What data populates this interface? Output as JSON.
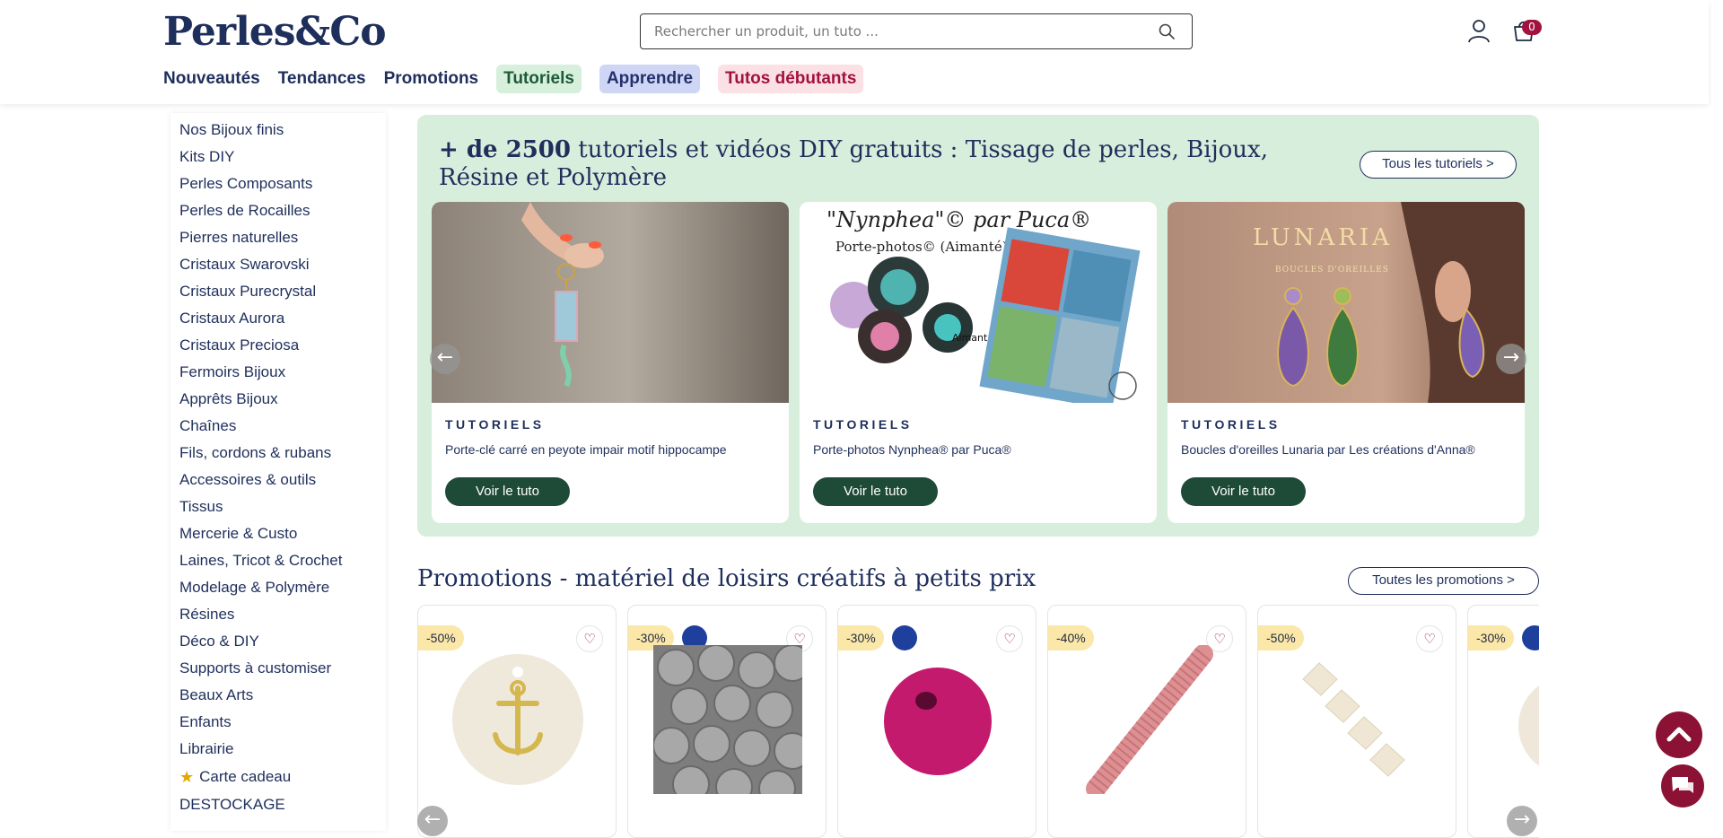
{
  "header": {
    "logo": "Perles&Co",
    "search_placeholder": "Rechercher un produit, un tuto ...",
    "cart_count": "0"
  },
  "nav": [
    {
      "label": "Nouveautés",
      "style": "plain"
    },
    {
      "label": "Tendances",
      "style": "plain"
    },
    {
      "label": "Promotions",
      "style": "plain"
    },
    {
      "label": "Tutoriels",
      "style": "green"
    },
    {
      "label": "Apprendre",
      "style": "blue"
    },
    {
      "label": "Tutos débutants",
      "style": "pink"
    }
  ],
  "sidebar": {
    "items": [
      "Nos Bijoux finis",
      "Kits DIY",
      "Perles Composants",
      "Perles de Rocailles",
      "Pierres naturelles",
      "Cristaux Swarovski",
      "Cristaux Purecrystal",
      "Cristaux Aurora",
      "Cristaux Preciosa",
      "Fermoirs Bijoux",
      "Apprêts Bijoux",
      "Chaînes",
      "Fils, cordons & rubans",
      "Accessoires & outils",
      "Tissus",
      "Mercerie & Custo",
      "Laines, Tricot & Crochet",
      "Modelage & Polymère",
      "Résines",
      "Déco & DIY",
      "Supports à customiser",
      "Beaux Arts",
      "Enfants",
      "Librairie"
    ],
    "gift_card": "Carte cadeau",
    "destockage": "DESTOCKAGE"
  },
  "tutorials": {
    "title_bold": "+ de 2500",
    "title_rest": " tutoriels et vidéos DIY gratuits : Tissage de perles, Bijoux, Résine et Polymère",
    "all_button": "Tous les tutoriels >",
    "cards": [
      {
        "kicker": "TUTORIELS",
        "title": "Porte-clé carré en peyote impair motif hippocampe",
        "button": "Voir le tuto"
      },
      {
        "kicker": "TUTORIELS",
        "title": "Porte-photos Nynphea® par Puca®",
        "button": "Voir le tuto",
        "img_line1": "\"Nynphea\"© par Puca®",
        "img_line2": "Porte-photos© (Aimanté)",
        "img_line3": "Aimant"
      },
      {
        "kicker": "TUTORIELS",
        "title": "Boucles d'oreilles Lunaria par Les créations d'Anna®",
        "button": "Voir le tuto",
        "img_line1": "LUNARIA",
        "img_line2": "BOUCLES D'OREILLES"
      }
    ]
  },
  "promotions": {
    "title": "Promotions - matériel de loisirs créatifs à petits prix",
    "all_button": "Toutes les promotions >",
    "products": [
      {
        "discount": "-50%",
        "eu": false
      },
      {
        "discount": "-30%",
        "eu": true
      },
      {
        "discount": "-30%",
        "eu": true
      },
      {
        "discount": "-40%",
        "eu": false
      },
      {
        "discount": "-50%",
        "eu": false
      },
      {
        "discount": "-30%",
        "eu": true
      }
    ]
  },
  "icons": {
    "search": "search-icon",
    "account": "user-icon",
    "cart": "cart-icon",
    "favorite": "heart-icon",
    "prev": "arrow-left-icon",
    "next": "arrow-right-icon",
    "scroll_top": "chevron-up-icon",
    "chat": "chat-icon"
  },
  "colors": {
    "brand_navy": "#1f2f5c",
    "accent_green": "#1e4a38",
    "accent_red": "#8b1234",
    "tuto_bg": "#d8eedc"
  }
}
